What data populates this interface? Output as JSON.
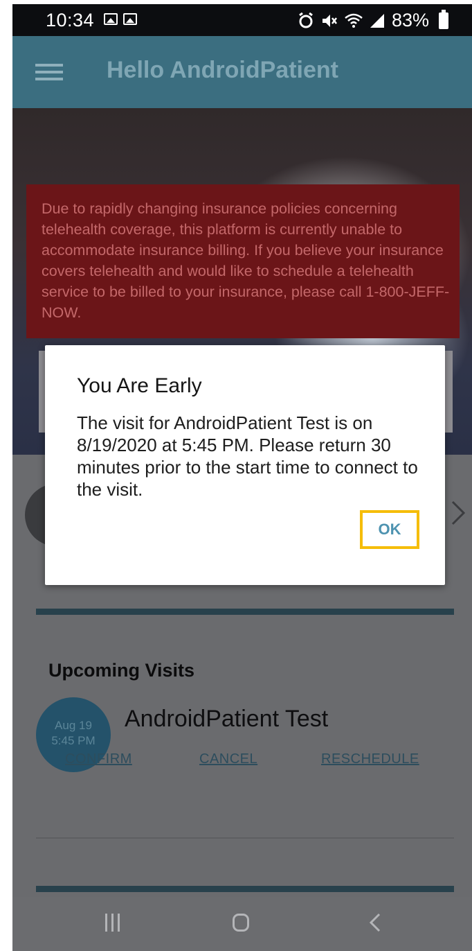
{
  "status_bar": {
    "time": "10:34",
    "battery": "83%"
  },
  "app_bar": {
    "title": "Hello AndroidPatient"
  },
  "notice": {
    "text": "Due to rapidly changing insurance policies concerning telehealth coverage, this platform is currently unable to accommodate insurance billing. If you believe your insurance covers telehealth and would like to schedule a telehealth service to be billed to your insurance, please call 1-800-JEFF-NOW."
  },
  "dialog": {
    "title": "You Are Early",
    "message": "The visit for AndroidPatient Test is on 8/19/2020 at 5:45 PM. Please return 30 minutes prior to the start time to connect to the visit.",
    "ok_label": "OK"
  },
  "upcoming": {
    "title": "Upcoming Visits",
    "visit": {
      "date": "Aug 19",
      "time": "5:45 PM",
      "name": "AndroidPatient Test",
      "actions": {
        "confirm": "CONFIRM",
        "cancel": "CANCEL",
        "reschedule": "RESCHEDULE"
      }
    }
  },
  "colors": {
    "app_bar": "#3b6e80",
    "notice_bg": "#6b1518",
    "badge": "#24526a",
    "ok_highlight": "#f5bd0a",
    "ok_text": "#4e93b0"
  },
  "icons": {
    "menu": "hamburger-icon",
    "next": "chevron-right-icon",
    "nav_recents": "recents-icon",
    "nav_home": "home-icon",
    "nav_back": "back-icon"
  }
}
